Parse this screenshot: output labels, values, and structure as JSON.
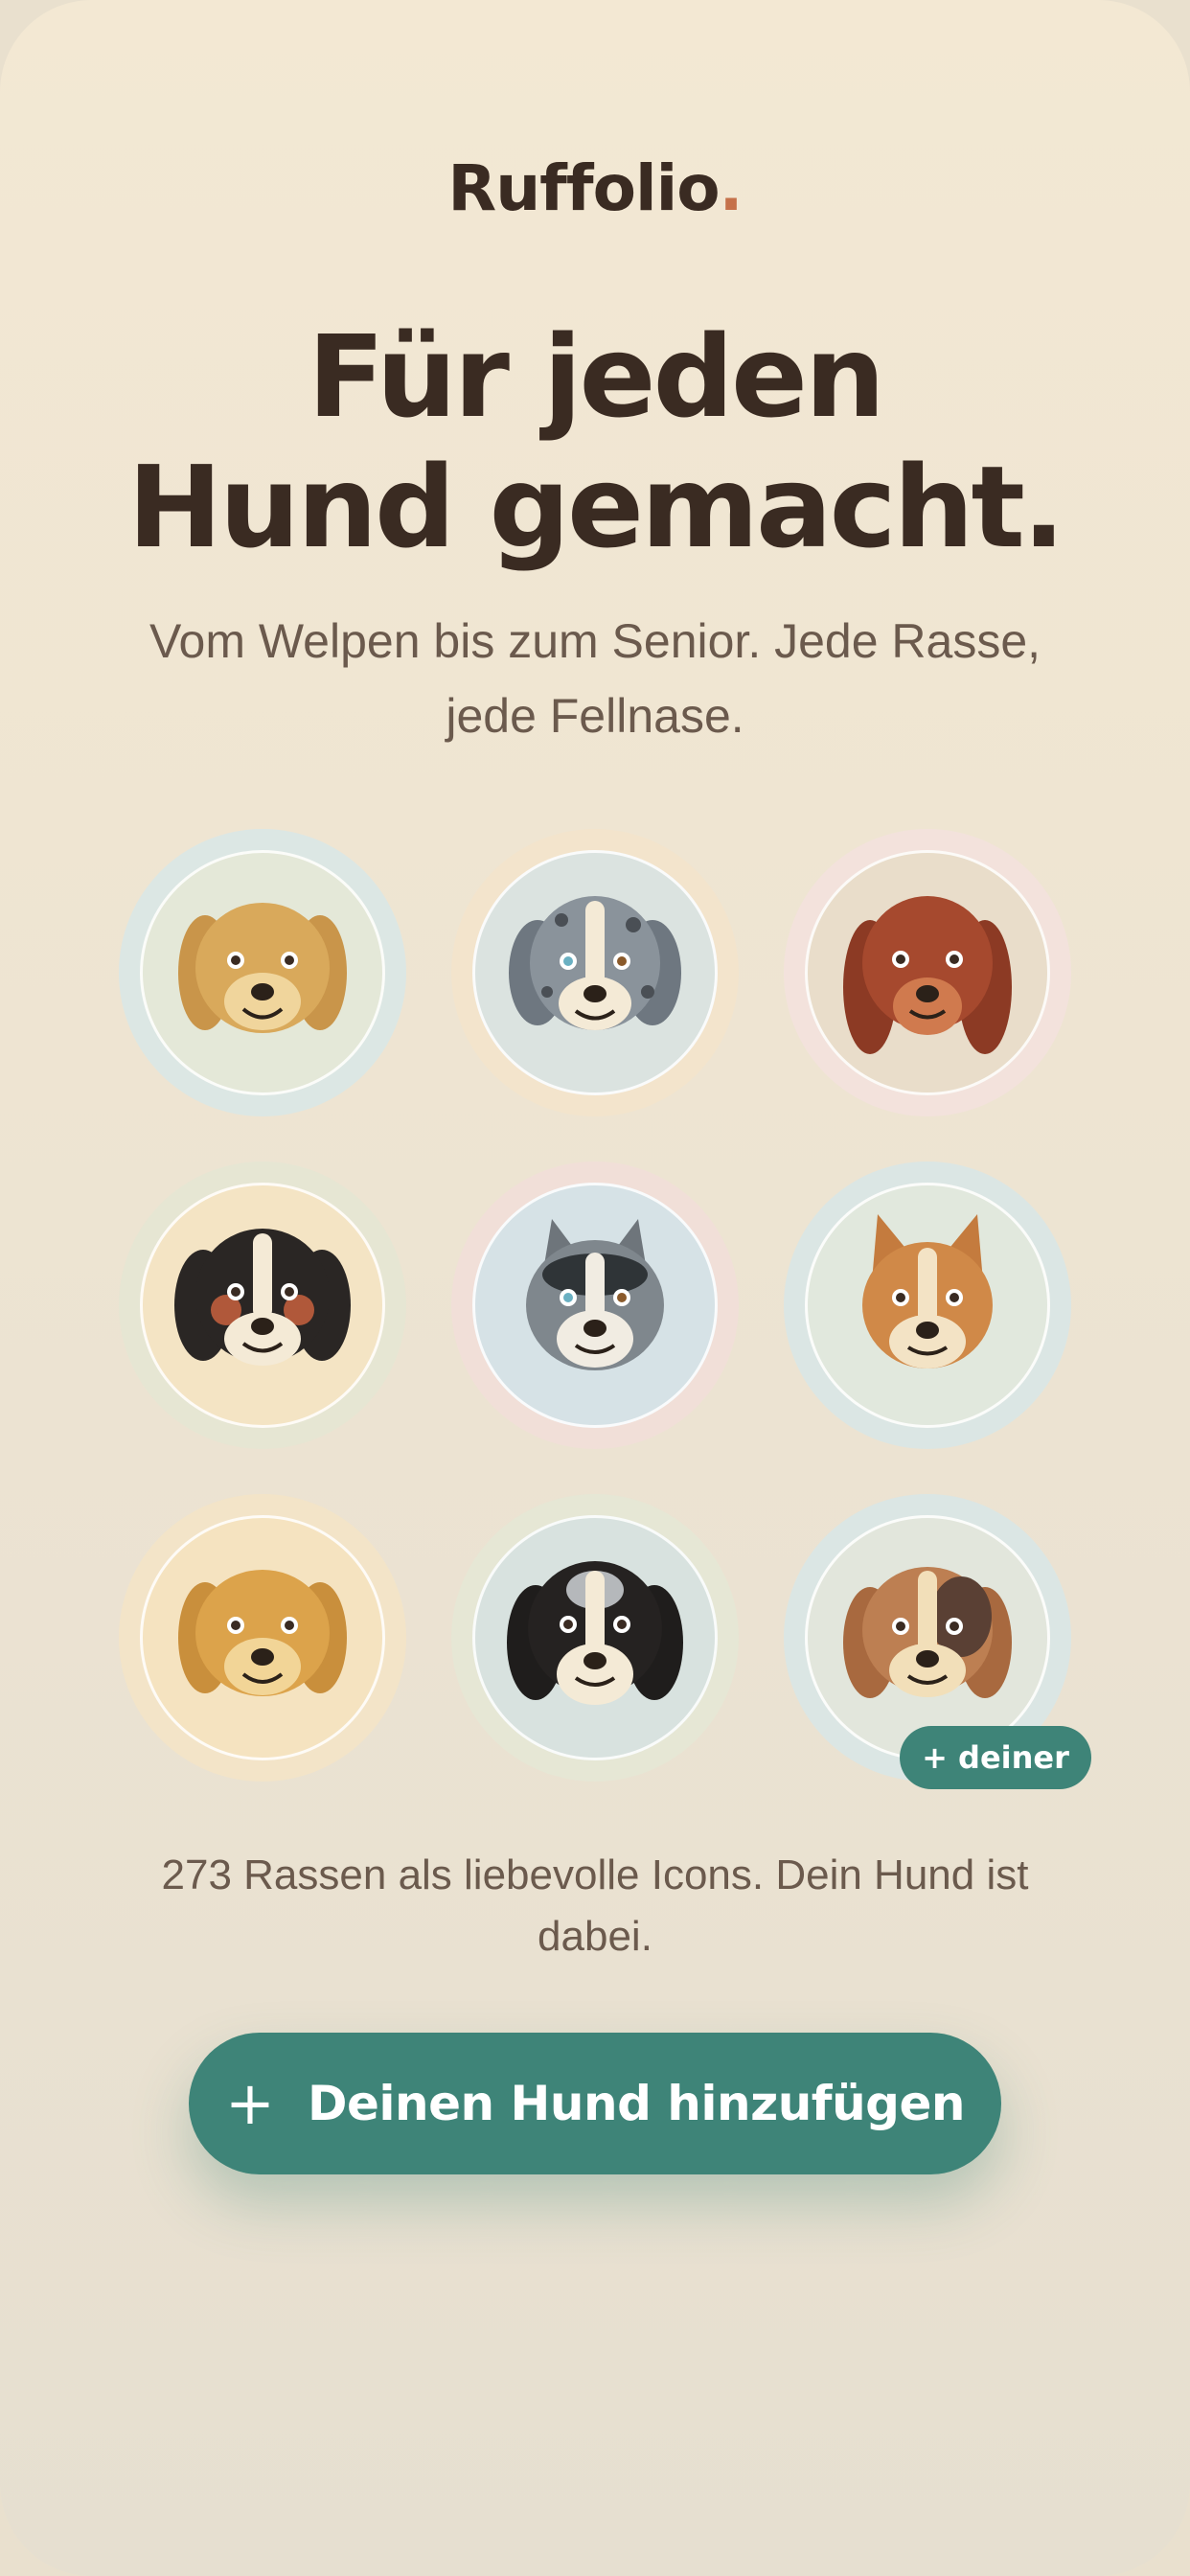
{
  "brand": {
    "name": "Ruffolio",
    "dot": "."
  },
  "hero": {
    "headline_line1": "Für jeden",
    "headline_line2": "Hund gemacht.",
    "subtitle": "Vom Welpen bis zum Senior. Jede Rasse, jede Fellnase."
  },
  "dogs": [
    {
      "name": "dog-avatar-golden",
      "icon": "golden-dog-icon"
    },
    {
      "name": "dog-avatar-merle",
      "icon": "merle-dog-icon"
    },
    {
      "name": "dog-avatar-setter",
      "icon": "red-setter-dog-icon"
    },
    {
      "name": "dog-avatar-bernese",
      "icon": "bernese-dog-icon"
    },
    {
      "name": "dog-avatar-husky",
      "icon": "husky-dog-icon"
    },
    {
      "name": "dog-avatar-corgi",
      "icon": "corgi-dog-icon"
    },
    {
      "name": "dog-avatar-retriever",
      "icon": "retriever-dog-icon"
    },
    {
      "name": "dog-avatar-border-collie",
      "icon": "border-collie-dog-icon"
    },
    {
      "name": "dog-avatar-beagle",
      "icon": "beagle-dog-icon"
    }
  ],
  "badge": {
    "label": "+ deiner"
  },
  "caption": "273 Rassen als liebevolle Icons. Dein Hund ist dabei.",
  "cta": {
    "plus": "+",
    "label": "Deinen Hund hinzufügen"
  },
  "colors": {
    "accent": "#3e8478",
    "brand_dot": "#c5714a",
    "text_dark": "#3a2b22",
    "text_muted": "#6b5a4d"
  }
}
